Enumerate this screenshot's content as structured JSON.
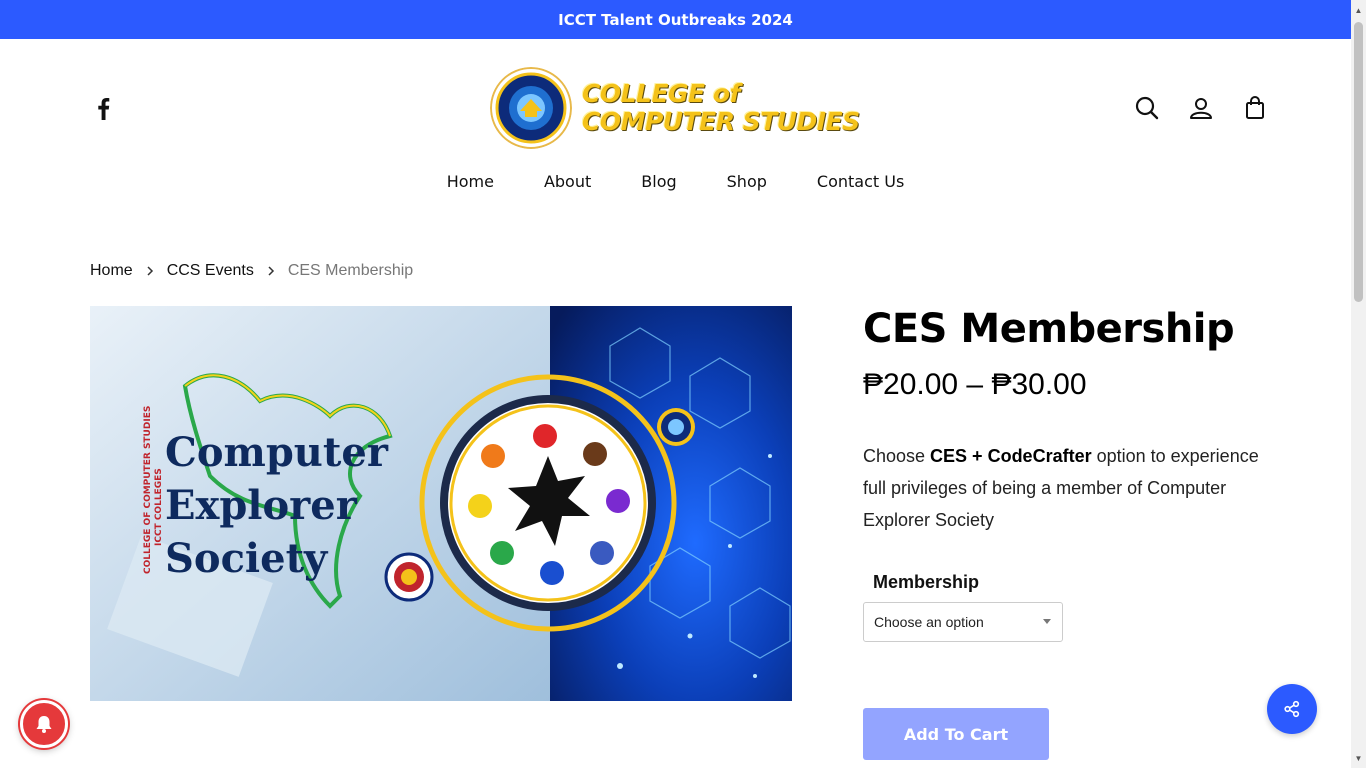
{
  "announcement": "ICCT Talent Outbreaks 2024",
  "logo": {
    "line1": "COLLEGE of",
    "line2": "COMPUTER STUDIES"
  },
  "nav": [
    "Home",
    "About",
    "Blog",
    "Shop",
    "Contact Us"
  ],
  "breadcrumb": {
    "home": "Home",
    "category": "CCS Events",
    "current": "CES Membership"
  },
  "product": {
    "title": "CES Membership",
    "price_range": "₱20.00 – ₱30.00",
    "description_pre": "Choose ",
    "description_bold": "CES + CodeCrafter",
    "description_post": " option to experience full privileges of being a member of Computer Explorer Society",
    "variation_label": "Membership",
    "select_value": "Choose an option",
    "add_to_cart": "Add To Cart"
  },
  "image_text": {
    "title_line1": "Computer",
    "title_line2": "Explorer",
    "title_line3": "Society",
    "side_line1": "COLLEGE OF COMPUTER STUDIES",
    "side_line2": "ICCT COLLEGES"
  },
  "icons": {
    "social": "facebook-icon",
    "header": [
      "search-icon",
      "account-icon",
      "cart-bag-icon"
    ],
    "share": "share-icon",
    "notification": "bell-icon"
  },
  "colors": {
    "accent": "#2c5aff",
    "button_disabled": "#93a4ff",
    "logo_gold": "#f4c21a",
    "notify_red": "#e5393b"
  }
}
